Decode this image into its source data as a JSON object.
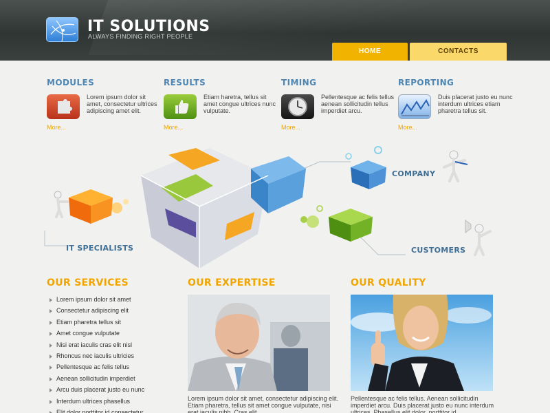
{
  "header": {
    "brand": "IT SOLUTIONS",
    "tagline": "ALWAYS FINDING RIGHT PEOPLE",
    "nav": [
      "HOME",
      "CONTACTS"
    ]
  },
  "features": [
    {
      "title": "MODULES",
      "text": "Lorem ipsum dolor sit amet, consectetur ultrices adipiscing amet elit.",
      "more": "More...",
      "icon": "puzzle-icon"
    },
    {
      "title": "RESULTS",
      "text": "Etiam haretra, tellus sit amet congue ultrices nunc vulputate.",
      "more": "More...",
      "icon": "thumbs-up-icon"
    },
    {
      "title": "TIMING",
      "text": "Pellentesque ac felis tellus aenean sollicitudin tellus imperdiet arcu.",
      "more": "More...",
      "icon": "clock-icon"
    },
    {
      "title": "REPORTING",
      "text": "Duis placerat justo eu nunc interdum ultrices etiam pharetra tellus sit.",
      "more": "More...",
      "icon": "chart-icon"
    }
  ],
  "diagram": {
    "labels": [
      "COMPANY",
      "IT SPECIALISTS",
      "CUSTOMERS"
    ]
  },
  "sections": {
    "services": {
      "title": "OUR SERVICES",
      "items": [
        "Lorem ipsum dolor sit amet",
        "Consectetur adipiscing elit",
        "Etiam pharetra tellus sit",
        "Amet congue vulputate",
        "Nisi erat iaculis cras elit nisl",
        "Rhoncus nec iaculis ultricies",
        "Pellentesque ac felis tellus",
        "Aenean sollicitudin imperdiet",
        "Arcu duis placerat justo eu nunc",
        "Interdum ultrices phasellus",
        "Elit dolor porttitor id consectetur"
      ]
    },
    "expertise": {
      "title": "OUR EXPERTISE",
      "text": "Lorem ipsum dolor sit amet, consectetur adipiscing elit. Etiam pharetra, tellus sit amet congue vulputate, nisi erat iaculis nibh. Cras elit"
    },
    "quality": {
      "title": "OUR QUALITY",
      "text": "Pellentesque ac felis tellus. Aenean sollicitudin imperdiet arcu. Duis placerat justo eu nunc interdum ultrices. Phasellus elit dolor, porttitor id"
    }
  },
  "colors": {
    "accent": "#f0a500",
    "heading_blue": "#4d86b3",
    "header_dark": "#2f3533"
  }
}
